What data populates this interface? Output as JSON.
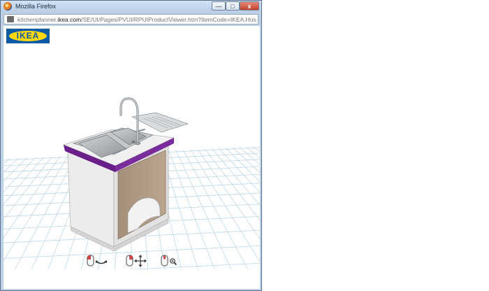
{
  "window": {
    "title": "Mozilla Firefox",
    "min_label": "—",
    "max_label": "□",
    "close_label": "x"
  },
  "address_bar": {
    "url_prefix": "kitchenplanner.",
    "url_domain": "ikea.com",
    "url_rest": "/SE/UI/Pages/PVUI/RPUIProductViewer.htm?ItemCode=IKEA.Host.Basecabi"
  },
  "viewer": {
    "logo_text": "IKEA",
    "product": "kitchen base cabinet with sink and faucet",
    "colors": {
      "worktop_edge": "#6a1e8a",
      "door": "#b09a85",
      "cabinet": "#eaeaea",
      "grid": "#bcd6e6"
    },
    "controls": [
      {
        "icon": "mouse-rotate-icon"
      },
      {
        "icon": "mouse-pan-icon"
      },
      {
        "icon": "mouse-zoom-icon"
      }
    ]
  }
}
